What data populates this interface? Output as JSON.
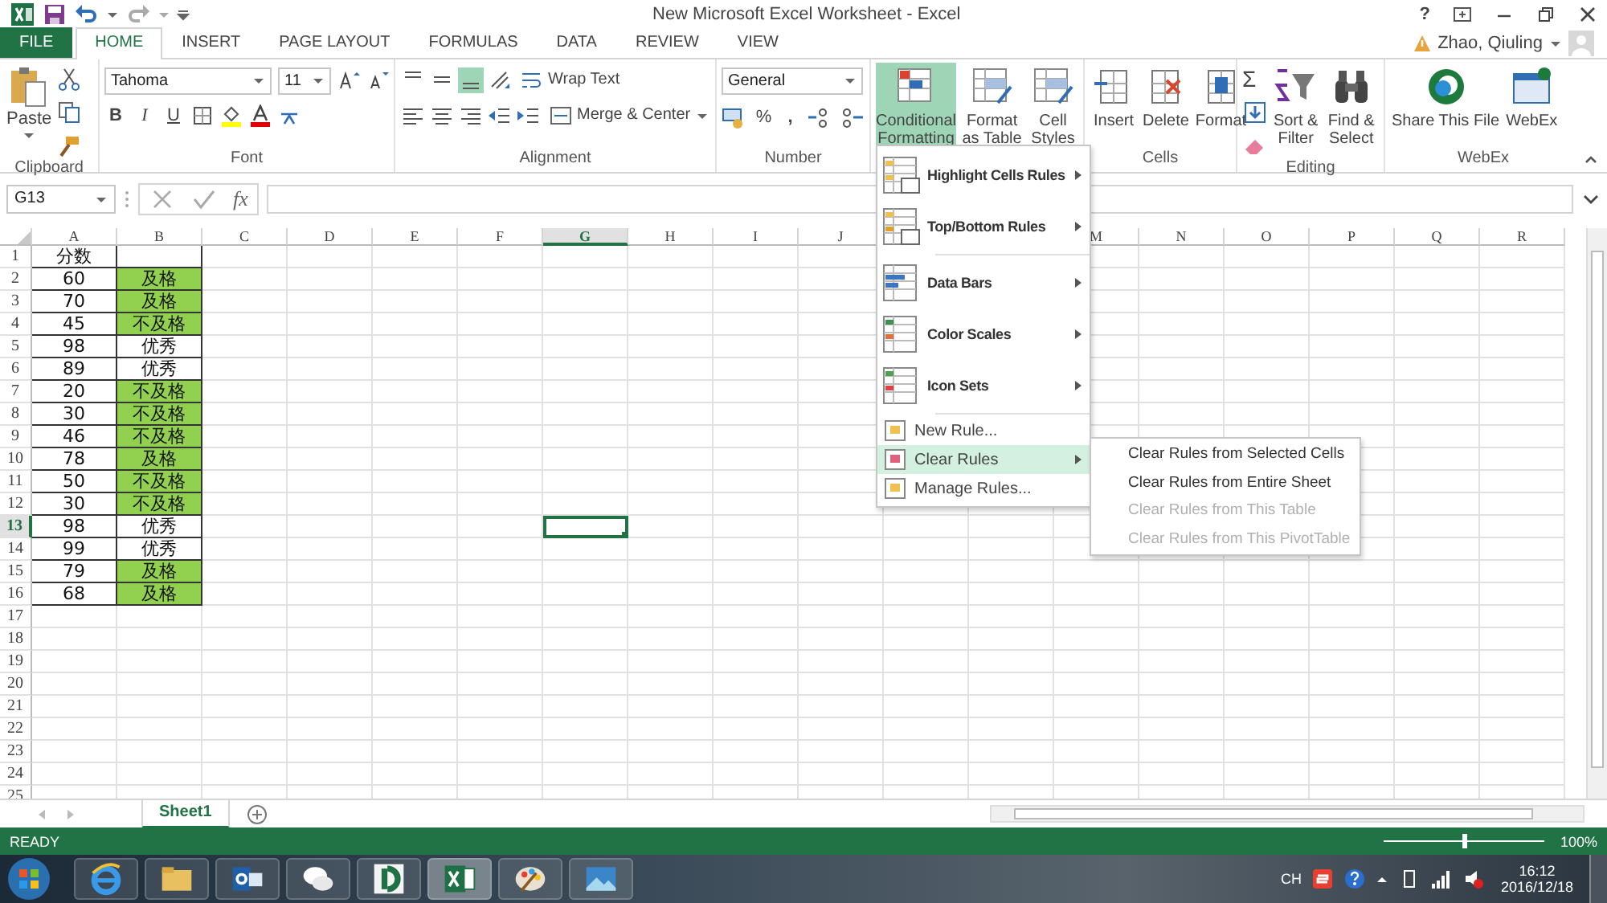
{
  "title_bar": {
    "title": "New Microsoft Excel Worksheet - Excel",
    "help": "?",
    "user": "Zhao, Qiuling"
  },
  "tabs": [
    {
      "label": "FILE",
      "kind": "file",
      "selected": false
    },
    {
      "label": "HOME",
      "kind": "tab",
      "selected": true
    },
    {
      "label": "INSERT",
      "kind": "tab",
      "selected": false
    },
    {
      "label": "PAGE LAYOUT",
      "kind": "tab",
      "selected": false
    },
    {
      "label": "FORMULAS",
      "kind": "tab",
      "selected": false
    },
    {
      "label": "DATA",
      "kind": "tab",
      "selected": false
    },
    {
      "label": "REVIEW",
      "kind": "tab",
      "selected": false
    },
    {
      "label": "VIEW",
      "kind": "tab",
      "selected": false
    }
  ],
  "ribbon": {
    "clipboard": {
      "paste": "Paste",
      "label": "Clipboard"
    },
    "font": {
      "name": "Tahoma",
      "size": "11",
      "bold": "B",
      "italic": "I",
      "underline": "U",
      "label": "Font"
    },
    "alignment": {
      "vertical_align": [
        {
          "selected": false
        },
        {
          "selected": false
        },
        {
          "selected": true
        }
      ],
      "wrap_text": "Wrap Text",
      "merge": "Merge & Center",
      "label": "Alignment"
    },
    "number": {
      "format": "General",
      "percent": "%",
      "comma": ",",
      "label": "Number"
    },
    "styles": [
      {
        "label": "Conditional Formatting",
        "selected": true
      },
      {
        "label": "Format as Table",
        "selected": false
      },
      {
        "label": "Cell Styles",
        "selected": false
      }
    ],
    "cells": {
      "buttons": [
        "Insert",
        "Delete",
        "Format"
      ],
      "label": "Cells"
    },
    "editing": {
      "sum": "Σ",
      "buttons": [
        "Sort & Filter",
        "Find & Select"
      ],
      "label": "Editing"
    },
    "webex": {
      "buttons": [
        "Share This File",
        "WebEx"
      ],
      "label": "WebEx"
    }
  },
  "formula_bar": {
    "name_box": "G13",
    "fx": "fx"
  },
  "columns": [
    {
      "kind": "letter",
      "label": "A",
      "selected": false
    },
    {
      "kind": "letter",
      "label": "B",
      "selected": false
    },
    {
      "kind": "letter",
      "label": "C",
      "selected": false
    },
    {
      "kind": "letter",
      "label": "D",
      "selected": false
    },
    {
      "kind": "letter",
      "label": "E",
      "selected": false
    },
    {
      "kind": "letter",
      "label": "F",
      "selected": false
    },
    {
      "kind": "letter",
      "label": "G",
      "selected": true
    },
    {
      "kind": "letter",
      "label": "H",
      "selected": false
    },
    {
      "kind": "letter",
      "label": "I",
      "selected": false
    },
    {
      "kind": "letter",
      "label": "J",
      "selected": false
    },
    {
      "kind": "covered"
    },
    {
      "kind": "covered"
    },
    {
      "kind": "letter",
      "label": "M",
      "selected": false
    },
    {
      "kind": "letter",
      "label": "N",
      "selected": false
    },
    {
      "kind": "letter",
      "label": "O",
      "selected": false
    },
    {
      "kind": "letter",
      "label": "P",
      "selected": false
    },
    {
      "kind": "letter",
      "label": "Q",
      "selected": false
    },
    {
      "kind": "letter",
      "label": "R",
      "selected": false
    }
  ],
  "rows": [
    {
      "label": "1",
      "selected": false,
      "a": "分数",
      "highlight": false
    },
    {
      "label": "2",
      "selected": false,
      "a": "60",
      "b": "及格",
      "highlight": true
    },
    {
      "label": "3",
      "selected": false,
      "a": "70",
      "b": "及格",
      "highlight": true
    },
    {
      "label": "4",
      "selected": false,
      "a": "45",
      "b": "不及格",
      "highlight": true
    },
    {
      "label": "5",
      "selected": false,
      "a": "98",
      "b": "优秀",
      "highlight": false
    },
    {
      "label": "6",
      "selected": false,
      "a": "89",
      "b": "优秀",
      "highlight": false
    },
    {
      "label": "7",
      "selected": false,
      "a": "20",
      "b": "不及格",
      "highlight": true
    },
    {
      "label": "8",
      "selected": false,
      "a": "30",
      "b": "不及格",
      "highlight": true
    },
    {
      "label": "9",
      "selected": false,
      "a": "46",
      "b": "不及格",
      "highlight": true
    },
    {
      "label": "10",
      "selected": false,
      "a": "78",
      "b": "及格",
      "highlight": true
    },
    {
      "label": "11",
      "selected": false,
      "a": "50",
      "b": "不及格",
      "highlight": true
    },
    {
      "label": "12",
      "selected": false,
      "a": "30",
      "b": "不及格",
      "highlight": true
    },
    {
      "label": "13",
      "selected": true,
      "a": "98",
      "b": "优秀",
      "highlight": false
    },
    {
      "label": "14",
      "selected": false,
      "a": "99",
      "b": "优秀",
      "highlight": false
    },
    {
      "label": "15",
      "selected": false,
      "a": "79",
      "b": "及格",
      "highlight": true
    },
    {
      "label": "16",
      "selected": false,
      "a": "68",
      "b": "及格",
      "highlight": true
    },
    {
      "label": "17",
      "selected": false
    },
    {
      "label": "18",
      "selected": false
    },
    {
      "label": "19",
      "selected": false
    },
    {
      "label": "20",
      "selected": false
    },
    {
      "label": "21",
      "selected": false
    },
    {
      "label": "22",
      "selected": false
    },
    {
      "label": "23",
      "selected": false
    },
    {
      "label": "24",
      "selected": false
    },
    {
      "label": "25",
      "selected": false
    }
  ],
  "menu": [
    {
      "label": "Highlight Cells Rules",
      "kind": "large",
      "selected": false,
      "submenu": true
    },
    {
      "label": "Top/Bottom Rules",
      "kind": "large",
      "selected": false,
      "submenu": true
    },
    {
      "label": "Data Bars",
      "kind": "large",
      "selected": false,
      "submenu": true
    },
    {
      "label": "Color Scales",
      "kind": "large",
      "selected": false,
      "submenu": true
    },
    {
      "label": "Icon Sets",
      "kind": "large",
      "selected": false,
      "submenu": true
    },
    {
      "label": "New Rule...",
      "kind": "small",
      "selected": false,
      "submenu": false
    },
    {
      "label": "Clear Rules",
      "kind": "small",
      "selected": true,
      "submenu": true
    },
    {
      "label": "Manage Rules...",
      "kind": "small",
      "selected": false,
      "submenu": false
    }
  ],
  "submenu": [
    {
      "label": "Clear Rules from Selected Cells",
      "disabled": false
    },
    {
      "label": "Clear Rules from Entire Sheet",
      "disabled": false
    },
    {
      "label": "Clear Rules from This Table",
      "disabled": true
    },
    {
      "label": "Clear Rules from This PivotTable",
      "disabled": true
    }
  ],
  "sheet_tabs": [
    {
      "label": "Sheet1",
      "selected": true
    }
  ],
  "status_bar": {
    "status": "READY",
    "zoom": {
      "level": 0.5,
      "reading": "100%"
    }
  },
  "taskbar": {
    "input_lang": "CH",
    "time": "16:12",
    "date": "2016/12/18"
  }
}
